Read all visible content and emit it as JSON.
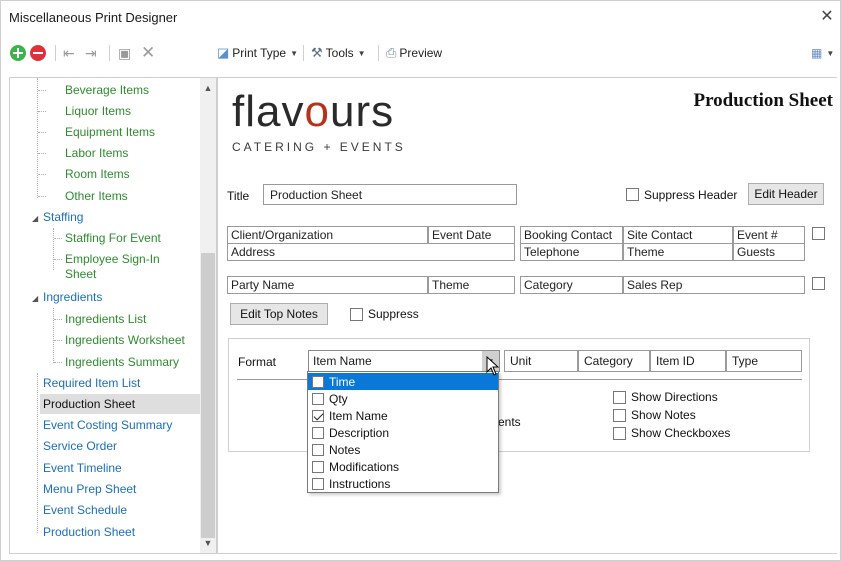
{
  "window": {
    "title": "Miscellaneous Print Designer",
    "close": "✕"
  },
  "toolbar": {
    "print_type": "Print Type",
    "tools": "Tools",
    "preview": "Preview"
  },
  "sidebar": {
    "items": [
      {
        "label": "Beverage Items"
      },
      {
        "label": "Liquor Items"
      },
      {
        "label": "Equipment Items"
      },
      {
        "label": "Labor Items"
      },
      {
        "label": "Room Items"
      },
      {
        "label": "Other Items"
      },
      {
        "label": "Staffing"
      },
      {
        "label": "Staffing For Event"
      },
      {
        "label": "Employee Sign-In"
      },
      {
        "label": "Sheet"
      },
      {
        "label": "Ingredients"
      },
      {
        "label": "Ingredients List"
      },
      {
        "label": "Ingredients Worksheet"
      },
      {
        "label": "Ingredients Summary"
      },
      {
        "label": "Required Item List"
      },
      {
        "label": "Production Sheet"
      },
      {
        "label": "Event Costing Summary"
      },
      {
        "label": "Service Order"
      },
      {
        "label": "Event Timeline"
      },
      {
        "label": "Menu Prep Sheet"
      },
      {
        "label": "Event Schedule"
      },
      {
        "label": "Production Sheet"
      }
    ]
  },
  "logo": {
    "word_a": "flav",
    "word_o": "o",
    "word_b": "urs",
    "sub": "CATERING + EVENTS"
  },
  "sheet_title": "Production Sheet",
  "title_row": {
    "label": "Title",
    "value": "Production Sheet",
    "suppress_header": "Suppress Header",
    "edit_header": "Edit Header"
  },
  "header_fields": {
    "row1": [
      "Client/Organization",
      "Event Date",
      "Booking Contact",
      "Site Contact",
      "Event #"
    ],
    "row2": [
      "Address",
      "Telephone",
      "Theme",
      "Guests"
    ],
    "row3": [
      "Party Name",
      "Theme",
      "Category",
      "Sales Rep"
    ]
  },
  "top_notes": {
    "edit": "Edit Top Notes",
    "suppress": "Suppress"
  },
  "format": {
    "label": "Format",
    "selected": "Item Name",
    "columns": [
      "Unit",
      "Category",
      "Item ID",
      "Type"
    ],
    "partial_text": "ents",
    "options_right": [
      "Show Directions",
      "Show Notes",
      "Show Checkboxes"
    ],
    "dropdown": [
      {
        "label": "Time",
        "checked": false,
        "active": true
      },
      {
        "label": "Qty",
        "checked": false,
        "active": false
      },
      {
        "label": "Item Name",
        "checked": true,
        "active": false
      },
      {
        "label": "Description",
        "checked": false,
        "active": false
      },
      {
        "label": "Notes",
        "checked": false,
        "active": false
      },
      {
        "label": "Modifications",
        "checked": false,
        "active": false
      },
      {
        "label": "Instructions",
        "checked": false,
        "active": false
      }
    ]
  }
}
